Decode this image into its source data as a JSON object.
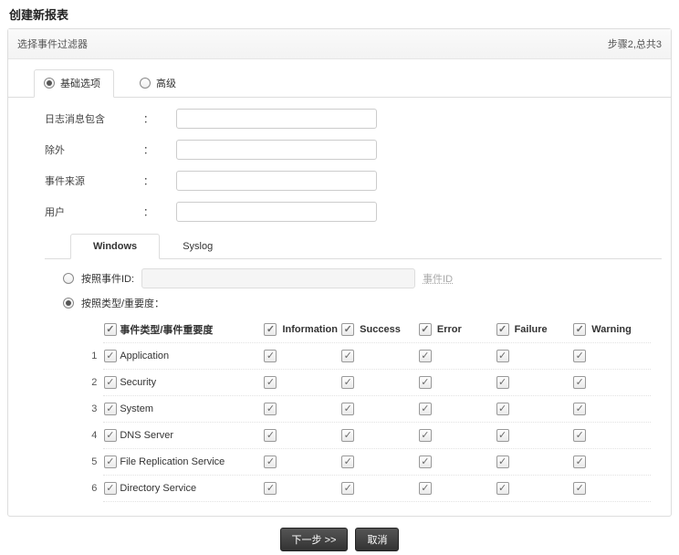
{
  "title": "创建新报表",
  "step": {
    "label": "选择事件过滤器",
    "progress": "步骤2,总共3"
  },
  "modeTabs": {
    "basic": "基础选项",
    "advanced_": "高级"
  },
  "form": {
    "contains": "日志消息包含",
    "except": "除外",
    "source": "事件来源",
    "user": "用户",
    "colon": "："
  },
  "innerTabs": {
    "windows": "Windows",
    "syslog": "Syslog"
  },
  "filter": {
    "byId": "按照事件ID:",
    "idPlaceholder": "事件ID",
    "byType": "按照类型/重要度：",
    "colHeader": "事件类型/事件重要度"
  },
  "chart_data": {
    "type": "table",
    "title": "按照类型/重要度",
    "columns": [
      "事件类型/事件重要度",
      "Information",
      "Success",
      "Error",
      "Failure",
      "Warning"
    ],
    "rows": [
      {
        "idx": 1,
        "name": "Application",
        "checked": true,
        "sev": [
          true,
          true,
          true,
          true,
          true
        ]
      },
      {
        "idx": 2,
        "name": "Security",
        "checked": true,
        "sev": [
          true,
          true,
          true,
          true,
          true
        ]
      },
      {
        "idx": 3,
        "name": "System",
        "checked": true,
        "sev": [
          true,
          true,
          true,
          true,
          true
        ]
      },
      {
        "idx": 4,
        "name": "DNS Server",
        "checked": true,
        "sev": [
          true,
          true,
          true,
          true,
          true
        ]
      },
      {
        "idx": 5,
        "name": "File Replication Service",
        "checked": true,
        "sev": [
          true,
          true,
          true,
          true,
          true
        ]
      },
      {
        "idx": 6,
        "name": "Directory Service",
        "checked": true,
        "sev": [
          true,
          true,
          true,
          true,
          true
        ]
      }
    ]
  },
  "severities": [
    "Information",
    "Success",
    "Error",
    "Failure",
    "Warning"
  ],
  "buttons": {
    "next": "下一步 >>",
    "cancel": "取消"
  }
}
